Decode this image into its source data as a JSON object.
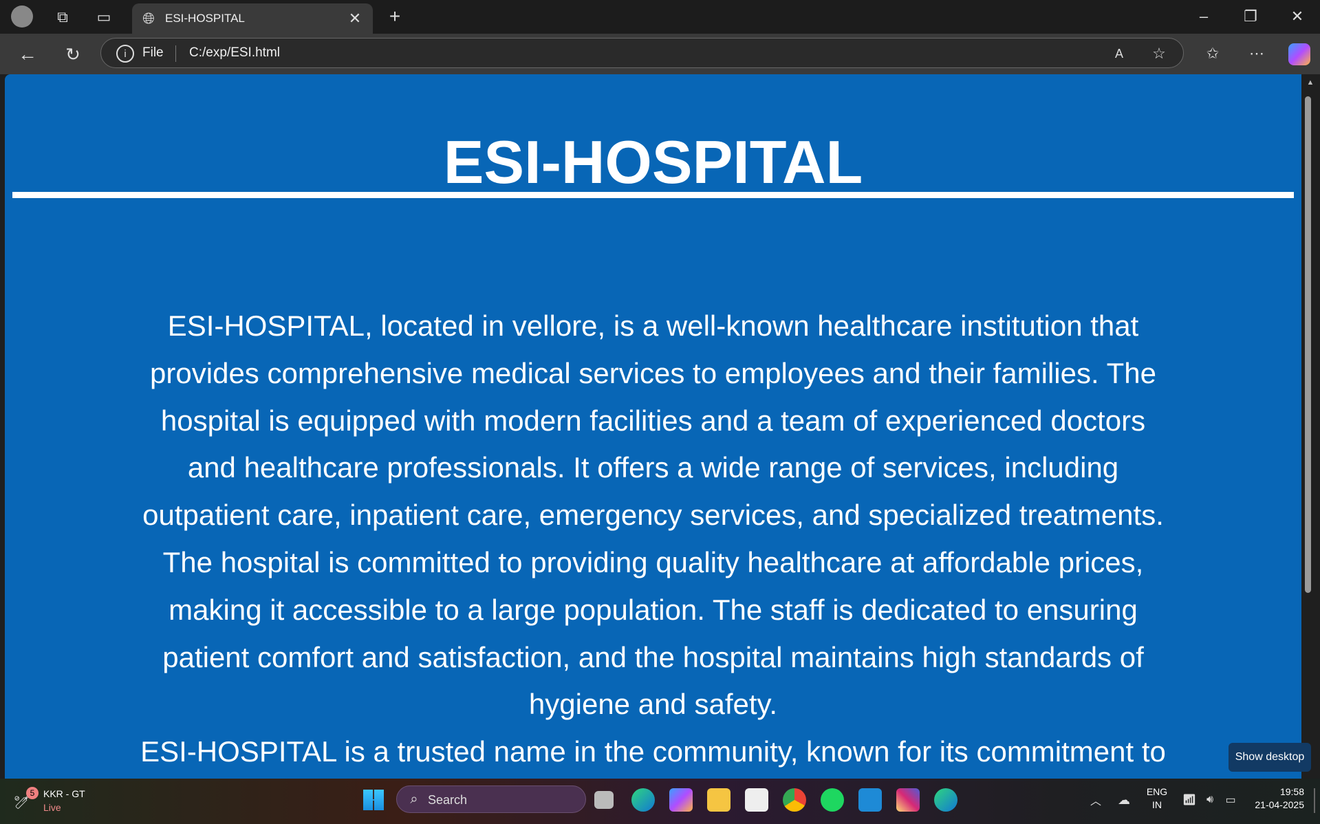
{
  "browser": {
    "tab_title": "ESI-HOSPITAL",
    "file_label": "File",
    "url": "C:/exp/ESI.html"
  },
  "page": {
    "heading": "ESI-HOSPITAL",
    "paragraph1_lines": [
      "ESI-HOSPITAL, located in vellore, is a well-known healthcare institution that",
      "provides comprehensive medical services to employees and their families. The",
      "hospital is equipped with modern facilities and a team of experienced doctors",
      "and healthcare professionals. It offers a wide range of services, including",
      "outpatient care, inpatient care, emergency services, and specialized treatments.",
      "The hospital is committed to providing quality healthcare at affordable prices,",
      "making it accessible to a large population. The staff is dedicated to ensuring",
      "patient comfort and satisfaction, and the hospital maintains high standards of",
      "hygiene and safety."
    ],
    "paragraph2_lines": [
      "ESI-HOSPITAL is a trusted name in the community, known for its commitment to"
    ]
  },
  "taskbar": {
    "widget_title": "KKR - GT",
    "widget_status": "Live",
    "widget_badge": "5",
    "search_placeholder": "Search",
    "lang": "ENG",
    "region": "IN",
    "time": "19:58",
    "date": "21-04-2025",
    "tooltip": "Show desktop"
  },
  "colors": {
    "page_bg": "#0866b6"
  }
}
